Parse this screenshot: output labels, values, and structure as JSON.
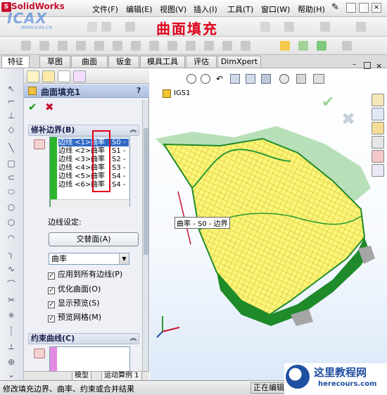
{
  "app": {
    "logo_text": "SolidWorks",
    "watermark": "ICAX",
    "watermark_url": "WWW.ICAX.CN"
  },
  "menu": {
    "items": [
      "文件(F)",
      "编辑(E)",
      "视图(V)",
      "插入(I)",
      "工具(T)",
      "窗口(W)",
      "帮助(H)"
    ]
  },
  "banner": {
    "title": "曲面填充",
    "color": "#e0001b"
  },
  "tabs": [
    "特征",
    "草图",
    "曲面",
    "钣金",
    "模具工具",
    "评估",
    "DimXpert"
  ],
  "active_tab": "特征",
  "property_manager": {
    "title": "曲面填充1",
    "help": "?",
    "ok_icon": "check-icon",
    "cancel_icon": "x-icon",
    "patch_boundary": {
      "header": "修补边界(B)",
      "rows": [
        {
          "edge": "边线 <1>",
          "type": "曲率",
          "set": "S0 - "
        },
        {
          "edge": "边线 <2>",
          "type": "曲率",
          "set": "S1 - "
        },
        {
          "edge": "边线 <3>",
          "type": "曲率",
          "set": "S2 - "
        },
        {
          "edge": "边线 <4>",
          "type": "曲率",
          "set": "S3 - "
        },
        {
          "edge": "边线 <5>",
          "type": "曲率",
          "set": "S4 - "
        },
        {
          "edge": "边线 <6>",
          "type": "曲率",
          "set": "S4 - "
        }
      ],
      "edge_setting_label": "边线设定:",
      "alternate_face_button": "交替面(A)",
      "curvature_select": "曲率",
      "checkboxes": [
        {
          "label": "应用到所有边线(P)",
          "checked": true
        },
        {
          "label": "优化曲面(O)",
          "checked": true
        },
        {
          "label": "显示预览(S)",
          "checked": true
        },
        {
          "label": "预览网格(M)",
          "checked": true
        }
      ]
    },
    "constraint_curves": {
      "header": "约束曲线(C)"
    }
  },
  "bottom_tabs": [
    "模型",
    "运动算例 1"
  ],
  "graphics": {
    "tree_item": "IGS1",
    "callout_label": "曲率 - S0 - 边界",
    "surface_color": "#f5f05a",
    "edge_color": "#1f8a2a"
  },
  "status": {
    "message": "修改填充边界、曲率、约束或合并结果",
    "mode": "正在编辑"
  },
  "brand": {
    "name": "这里教程网",
    "url": "herecours.com",
    "color": "#1f4fa0"
  }
}
